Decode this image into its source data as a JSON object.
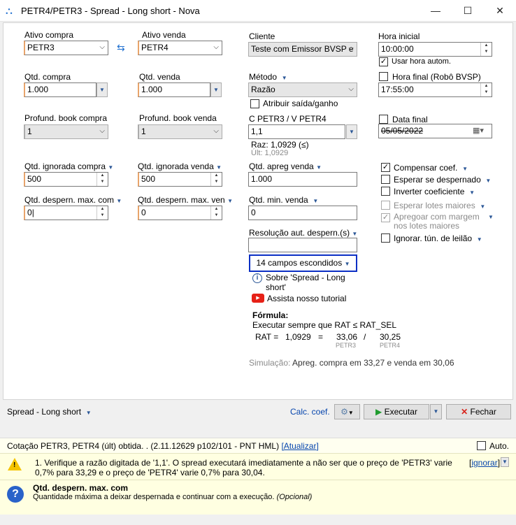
{
  "window": {
    "title": "PETR4/PETR3 - Spread - Long short - Nova",
    "minimize": "—",
    "maximize": "☐",
    "close": "✕"
  },
  "col1": {
    "ativo_compra_label": "Ativo compra",
    "ativo_compra_value": "PETR3",
    "qtd_compra_label": "Qtd. compra",
    "qtd_compra_value": "1.000",
    "book_compra_label": "Profund. book compra",
    "book_compra_value": "1",
    "qtd_ign_compra_label": "Qtd. ignorada compra",
    "qtd_ign_compra_value": "500",
    "desp_max_com_label": "Qtd. despern. max. com",
    "desp_max_com_value": "0"
  },
  "col2": {
    "ativo_venda_label": "Ativo venda",
    "ativo_venda_value": "PETR4",
    "qtd_venda_label": "Qtd. venda",
    "qtd_venda_value": "1.000",
    "book_venda_label": "Profund. book venda",
    "book_venda_value": "1",
    "qtd_ign_venda_label": "Qtd. ignorada venda",
    "qtd_ign_venda_value": "500",
    "desp_max_ven_label": "Qtd. despern. max. ven",
    "desp_max_ven_value": "0"
  },
  "col3": {
    "cliente_label": "Cliente",
    "cliente_value": "Teste com Emissor BVSP e",
    "metodo_label": "Método",
    "metodo_value": "Razão",
    "atribuir_label": "Atribuir saída/ganho",
    "c_label": "C PETR3 / V PETR4",
    "c_value": "1,1",
    "raz_text": "Raz: 1,0929 (≤)",
    "ult_text": "Últ: 1,0929",
    "apreg_label": "Qtd. apreg venda",
    "apreg_value": "1.000",
    "min_venda_label": "Qtd. min. venda",
    "min_venda_value": "0",
    "resolucao_label": "Resolução aut. despern.(s)",
    "resolucao_value": "",
    "campos_escondidos": "14 campos escondidos",
    "sobre_text": "Sobre 'Spread - Long short'",
    "tutorial_text": "Assista nosso tutorial",
    "formula_title": "Fórmula:",
    "formula_rule": "Executar sempre que RAT ≤ RAT_SEL",
    "rat_label": "RAT =",
    "rat_value": "1,0929",
    "eq": "=",
    "num_value": "33,06",
    "num_sub": "PETR3",
    "div": "/",
    "den_value": "30,25",
    "den_sub": "PETR4",
    "sim_label": "Simulação:",
    "sim_text": "Apreg. compra em 33,27 e venda em 30,06"
  },
  "col4": {
    "hora_inicial_label": "Hora inicial",
    "hora_inicial_value": "10:00:00",
    "usar_hora_label": "Usar hora autom.",
    "hora_final_label": "Hora final (Robô BVSP)",
    "hora_final_value": "17:55:00",
    "data_final_label": "Data final",
    "data_final_value": "05/05/2022",
    "opts": [
      {
        "label": "Compensar coef.",
        "checked": "✓"
      },
      {
        "label": "Esperar se despernado",
        "checked": ""
      },
      {
        "label": "Inverter coeficiente",
        "checked": ""
      },
      {
        "label": "Esperar lotes maiores",
        "checked": ""
      },
      {
        "label": "Apregoar com margem nos lotes maiores",
        "checked": "✓"
      },
      {
        "label": "Ignorar. tún. de leilão",
        "checked": ""
      }
    ]
  },
  "bottom": {
    "strategy": "Spread - Long short",
    "calc": "Calc. coef.",
    "executar": "Executar",
    "fechar": "Fechar"
  },
  "status": {
    "text": "Cotação PETR3, PETR4 (últ) obtida. .  (2.11.12629 p102/101 - PNT HML)",
    "link": "[Atualizar]",
    "auto": "Auto."
  },
  "warning": {
    "text": "1. Verifique a razão digitada de '1,1'. O spread executará imediatamente a não ser que o preço de 'PETR3' varie 0,7% para 33,29 e o preço de 'PETR4' varie 0,7% para 30,04.",
    "ignorar": "ignorar"
  },
  "help": {
    "title": "Qtd. despern. max. com",
    "text": "Quantidade máxima a deixar despernada e continuar com a execução.",
    "optional": "(Opcional)"
  },
  "colors": {
    "accent": "#0b2fc4",
    "link": "#0645ad",
    "warn": "#ffffe1"
  }
}
